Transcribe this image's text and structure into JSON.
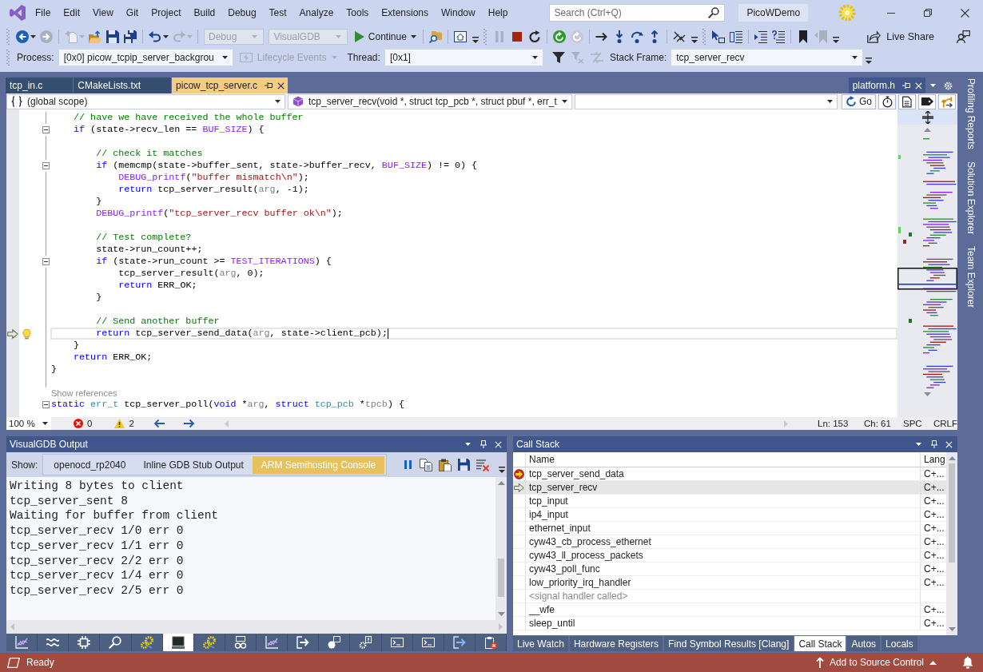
{
  "title_bar": {
    "menu": [
      "File",
      "Edit",
      "View",
      "Git",
      "Project",
      "Build",
      "Debug",
      "Test",
      "Analyze",
      "Tools",
      "Extensions",
      "Window",
      "Help"
    ],
    "search": {
      "placeholder": "Search (Ctrl+Q)"
    },
    "solution": "PicoWDemo"
  },
  "toolbar": {
    "items": [
      {
        "kind": "grip"
      },
      {
        "kind": "back",
        "disabled": false,
        "caret": true
      },
      {
        "kind": "forward",
        "disabled": true,
        "caret": false
      },
      {
        "kind": "separator"
      },
      {
        "kind": "new-item",
        "disabled": true,
        "caret": true
      },
      {
        "kind": "open-folder",
        "disabled": false,
        "caret": false
      },
      {
        "kind": "save",
        "disabled": false,
        "caret": false
      },
      {
        "kind": "save-all",
        "disabled": false,
        "caret": false
      },
      {
        "kind": "separator"
      },
      {
        "kind": "undo",
        "disabled": false,
        "caret": true
      },
      {
        "kind": "redo",
        "disabled": true,
        "caret": true
      },
      {
        "kind": "separator"
      },
      {
        "kind": "combo",
        "value": "Debug",
        "disabled": true
      },
      {
        "kind": "combo",
        "value": "VisualGDB",
        "disabled": true
      },
      {
        "kind": "run",
        "label": "Continue",
        "disabled": false,
        "caret": true
      },
      {
        "kind": "separator"
      },
      {
        "kind": "find-files",
        "disabled": false,
        "caret": false
      },
      {
        "kind": "separator"
      },
      {
        "kind": "home-window",
        "disabled": false,
        "caret": false
      },
      {
        "kind": "overflow"
      },
      {
        "kind": "grip"
      },
      {
        "kind": "pause",
        "disabled": true,
        "caret": false
      },
      {
        "kind": "stop",
        "disabled": false,
        "caret": false
      },
      {
        "kind": "restart",
        "disabled": false,
        "caret": false
      },
      {
        "kind": "separator"
      },
      {
        "kind": "refresh",
        "disabled": false,
        "caret": false
      },
      {
        "kind": "refresh",
        "disabled": true,
        "caret": false
      },
      {
        "kind": "separator"
      },
      {
        "kind": "next-statement",
        "disabled": false,
        "caret": false
      },
      {
        "kind": "step-into",
        "disabled": false,
        "caret": false
      },
      {
        "kind": "step-over",
        "disabled": false,
        "caret": false
      },
      {
        "kind": "step-out",
        "disabled": false,
        "caret": false
      },
      {
        "kind": "separator"
      },
      {
        "kind": "crossed-lines",
        "disabled": false,
        "caret": false
      },
      {
        "kind": "overflow"
      },
      {
        "kind": "grip"
      },
      {
        "kind": "cursor-box",
        "disabled": false,
        "caret": false
      },
      {
        "kind": "panel-list",
        "disabled": false,
        "caret": false
      },
      {
        "kind": "separator"
      },
      {
        "kind": "indent-lines",
        "disabled": false,
        "caret": false
      },
      {
        "kind": "comment-lines",
        "disabled": false,
        "caret": false
      },
      {
        "kind": "separator"
      },
      {
        "kind": "bookmark",
        "disabled": false,
        "caret": false
      },
      {
        "kind": "bookmark-back",
        "disabled": true,
        "caret": false
      },
      {
        "kind": "overflow"
      }
    ],
    "live_share": "Live Share"
  },
  "debug_location": {
    "process_label": "Process:",
    "process": "[0x0] picow_tcpip_server_backgrou",
    "lifecycle": {
      "label": "Lifecycle Events",
      "disabled": true
    },
    "thread_label": "Thread:",
    "thread": "[0x1]",
    "flag_buttons": [
      {
        "kind": "filter",
        "disabled": false
      },
      {
        "kind": "filter-clear",
        "disabled": true
      },
      {
        "kind": "crossed-arrows",
        "disabled": true
      }
    ],
    "stack_frame_label": "Stack Frame:",
    "stack_frame": "tcp_server_recv"
  },
  "documents": {
    "tabs": [
      {
        "label": "tcp_in.c",
        "selected": false
      },
      {
        "label": "CMakeLists.txt",
        "selected": false
      },
      {
        "label": "picow_tcp_server.c",
        "selected": true
      }
    ],
    "side_tab": {
      "label": "platform.h"
    }
  },
  "navigation": {
    "scope": "(global scope)",
    "member": "tcp_server_recv(void *, struct tcp_pcb *, struct pbuf *, err_t",
    "go": "Go"
  },
  "editor": {
    "function_body": [
      {
        "kind": "code",
        "current": false,
        "foldable": false,
        "stack_frame": false,
        "lightbulb": false,
        "segments": [
          {
            "text": "// have we have received the whole buffer",
            "kind": "comment"
          }
        ]
      },
      {
        "kind": "code",
        "current": false,
        "foldable": true,
        "stack_frame": false,
        "lightbulb": false,
        "segments": [
          {
            "text": "if",
            "kind": "keyword"
          },
          {
            "text": " (state->recv_len == ",
            "kind": "plain"
          },
          {
            "text": "BUF_SIZE",
            "kind": "macro"
          },
          {
            "text": ") {",
            "kind": "plain"
          }
        ],
        "children": [
          {
            "kind": "blank",
            "current": false,
            "foldable": false,
            "stack_frame": false,
            "lightbulb": false
          },
          {
            "kind": "code",
            "current": false,
            "foldable": false,
            "stack_frame": false,
            "lightbulb": false,
            "segments": [
              {
                "text": "// check it matches",
                "kind": "comment"
              }
            ]
          },
          {
            "kind": "code",
            "current": false,
            "foldable": true,
            "stack_frame": false,
            "lightbulb": false,
            "segments": [
              {
                "text": "if",
                "kind": "keyword"
              },
              {
                "text": " (memcmp(state->buffer_sent, state->buffer_recv, ",
                "kind": "plain"
              },
              {
                "text": "BUF_SIZE",
                "kind": "macro"
              },
              {
                "text": ") != 0) {",
                "kind": "plain"
              }
            ],
            "children": [
              {
                "kind": "code",
                "current": false,
                "foldable": false,
                "stack_frame": false,
                "lightbulb": false,
                "segments": [
                  {
                    "text": "DEBUG_printf",
                    "kind": "macro"
                  },
                  {
                    "text": "(",
                    "kind": "plain"
                  },
                  {
                    "text": "\"buffer mismatch\\n\"",
                    "kind": "string"
                  },
                  {
                    "text": ");",
                    "kind": "plain"
                  }
                ]
              },
              {
                "kind": "code",
                "current": false,
                "foldable": false,
                "stack_frame": false,
                "lightbulb": false,
                "segments": [
                  {
                    "text": "return",
                    "kind": "keyword"
                  },
                  {
                    "text": " tcp_server_result(",
                    "kind": "plain"
                  },
                  {
                    "text": "arg",
                    "kind": "param"
                  },
                  {
                    "text": ", -1);",
                    "kind": "plain"
                  }
                ]
              }
            ]
          },
          {
            "kind": "code",
            "current": false,
            "foldable": false,
            "stack_frame": false,
            "lightbulb": false,
            "segments": [
              {
                "text": "}",
                "kind": "plain"
              }
            ]
          },
          {
            "kind": "code",
            "current": false,
            "foldable": false,
            "stack_frame": false,
            "lightbulb": false,
            "segments": [
              {
                "text": "DEBUG_printf",
                "kind": "macro"
              },
              {
                "text": "(",
                "kind": "plain"
              },
              {
                "text": "\"tcp_server_recv buffer ok\\n\"",
                "kind": "string"
              },
              {
                "text": ");",
                "kind": "plain"
              }
            ]
          },
          {
            "kind": "blank",
            "current": false,
            "foldable": false,
            "stack_frame": false,
            "lightbulb": false
          },
          {
            "kind": "code",
            "current": false,
            "foldable": false,
            "stack_frame": false,
            "lightbulb": false,
            "segments": [
              {
                "text": "// Test complete?",
                "kind": "comment"
              }
            ]
          },
          {
            "kind": "code",
            "current": false,
            "foldable": false,
            "stack_frame": false,
            "lightbulb": false,
            "segments": [
              {
                "text": "state->run_count++;",
                "kind": "plain"
              }
            ]
          },
          {
            "kind": "code",
            "current": false,
            "foldable": true,
            "stack_frame": false,
            "lightbulb": false,
            "segments": [
              {
                "text": "if",
                "kind": "keyword"
              },
              {
                "text": " (state->run_count >= ",
                "kind": "plain"
              },
              {
                "text": "TEST_ITERATIONS",
                "kind": "macro"
              },
              {
                "text": ") {",
                "kind": "plain"
              }
            ],
            "children": [
              {
                "kind": "code",
                "current": false,
                "foldable": false,
                "stack_frame": false,
                "lightbulb": false,
                "segments": [
                  {
                    "text": "tcp_server_result(",
                    "kind": "plain"
                  },
                  {
                    "text": "arg",
                    "kind": "param"
                  },
                  {
                    "text": ", 0);",
                    "kind": "plain"
                  }
                ]
              },
              {
                "kind": "code",
                "current": false,
                "foldable": false,
                "stack_frame": false,
                "lightbulb": false,
                "segments": [
                  {
                    "text": "return",
                    "kind": "keyword"
                  },
                  {
                    "text": " ERR_OK;",
                    "kind": "plain"
                  }
                ]
              }
            ]
          },
          {
            "kind": "code",
            "current": false,
            "foldable": false,
            "stack_frame": false,
            "lightbulb": false,
            "segments": [
              {
                "text": "}",
                "kind": "plain"
              }
            ]
          },
          {
            "kind": "blank",
            "current": false,
            "foldable": false,
            "stack_frame": false,
            "lightbulb": false
          },
          {
            "kind": "code",
            "current": false,
            "foldable": false,
            "stack_frame": false,
            "lightbulb": false,
            "segments": [
              {
                "text": "// Send another buffer",
                "kind": "comment"
              }
            ]
          },
          {
            "kind": "code",
            "current": true,
            "foldable": false,
            "stack_frame": true,
            "lightbulb": true,
            "segments": [
              {
                "text": "return",
                "kind": "keyword"
              },
              {
                "text": " tcp_server_send_data(",
                "kind": "plain"
              },
              {
                "text": "arg",
                "kind": "param"
              },
              {
                "text": ", state->client_pcb);",
                "kind": "plain"
              }
            ]
          }
        ]
      },
      {
        "kind": "code",
        "current": false,
        "foldable": false,
        "stack_frame": false,
        "lightbulb": false,
        "segments": [
          {
            "text": "}",
            "kind": "plain"
          }
        ]
      },
      {
        "kind": "code",
        "current": false,
        "foldable": false,
        "stack_frame": false,
        "lightbulb": false,
        "segments": [
          {
            "text": "return",
            "kind": "keyword"
          },
          {
            "text": " ERR_OK;",
            "kind": "plain"
          }
        ]
      }
    ],
    "lines_after": [
      {
        "kind": "code",
        "current": false,
        "foldable": false,
        "stack_frame": false,
        "lightbulb": false,
        "segments": [
          {
            "text": "}",
            "kind": "plain"
          }
        ]
      },
      {
        "kind": "blank",
        "current": false,
        "foldable": false,
        "stack_frame": false,
        "lightbulb": false
      },
      {
        "kind": "lens",
        "text": "Show references",
        "current": false,
        "foldable": false,
        "stack_frame": false,
        "lightbulb": false
      },
      {
        "kind": "code",
        "current": false,
        "foldable": true,
        "stack_frame": false,
        "lightbulb": false,
        "segments": [
          {
            "text": "static",
            "kind": "keyword"
          },
          {
            "text": " err_t",
            "kind": "type"
          },
          {
            "text": " tcp_server_poll(",
            "kind": "plain"
          },
          {
            "text": "void",
            "kind": "keyword"
          },
          {
            "text": " *",
            "kind": "plain"
          },
          {
            "text": "arg",
            "kind": "param"
          },
          {
            "text": ", ",
            "kind": "plain"
          },
          {
            "text": "struct",
            "kind": "keyword"
          },
          {
            "text": " tcp_pcb",
            "kind": "type"
          },
          {
            "text": " *",
            "kind": "plain"
          },
          {
            "text": "tpcb",
            "kind": "param"
          },
          {
            "text": ") {",
            "kind": "plain"
          }
        ]
      }
    ]
  },
  "editor_status": {
    "zoom": "100 %",
    "errors": "0",
    "warnings": "2",
    "line": "Ln: 153",
    "column": "Ch: 61",
    "indentation": "SPC",
    "line_ending": "CRLF"
  },
  "output": {
    "title": "VisualGDB Output",
    "show_label": "Show:",
    "sources": [
      {
        "label": "openocd_rp2040",
        "selected": false
      },
      {
        "label": "Inline GDB Stub Output",
        "selected": false
      },
      {
        "label": "ARM Semihosting Console",
        "selected": true
      }
    ],
    "lines": [
      "Writing 8 bytes to client",
      "tcp_server_sent 8",
      "Waiting for buffer from client",
      "tcp_server_recv 1/0 err 0",
      "tcp_server_recv 1/1 err 0",
      "tcp_server_recv 2/2 err 0",
      "tcp_server_recv 1/4 err 0",
      "tcp_server_recv 2/5 err 0"
    ],
    "tool_tabs": [
      {
        "kind": "chart",
        "selected": false
      },
      {
        "kind": "wave",
        "selected": false
      },
      {
        "kind": "chip",
        "selected": false
      },
      {
        "kind": "search",
        "selected": false
      },
      {
        "kind": "gears",
        "selected": false
      },
      {
        "kind": "terminal",
        "selected": true
      },
      {
        "kind": "gears",
        "selected": false
      },
      {
        "kind": "glasses",
        "selected": false
      },
      {
        "kind": "chart",
        "selected": false
      },
      {
        "kind": "arrow-box",
        "selected": false
      },
      {
        "kind": "shapes",
        "selected": false
      },
      {
        "kind": "gear-alert",
        "selected": false
      },
      {
        "kind": "console",
        "selected": false
      },
      {
        "kind": "console",
        "selected": false
      },
      {
        "kind": "arrow-box-blue",
        "selected": false
      },
      {
        "kind": "clipboard-delete",
        "selected": false
      }
    ]
  },
  "call_stack": {
    "title": "Call Stack",
    "columns": [
      "Name",
      "Lang"
    ],
    "rows": [
      {
        "kind": "function",
        "name": "tcp_server_send_data",
        "lang": "C+...",
        "current": true,
        "selected": false
      },
      {
        "kind": "function",
        "name": "tcp_server_recv",
        "lang": "C+...",
        "current": false,
        "selected": true
      },
      {
        "kind": "function",
        "name": "tcp_input",
        "lang": "C+...",
        "current": false,
        "selected": false
      },
      {
        "kind": "function",
        "name": "ip4_input",
        "lang": "C+...",
        "current": false,
        "selected": false
      },
      {
        "kind": "function",
        "name": "ethernet_input",
        "lang": "C+...",
        "current": false,
        "selected": false
      },
      {
        "kind": "function",
        "name": "cyw43_cb_process_ethernet",
        "lang": "C+...",
        "current": false,
        "selected": false
      },
      {
        "kind": "function",
        "name": "cyw43_ll_process_packets",
        "lang": "C+...",
        "current": false,
        "selected": false
      },
      {
        "kind": "function",
        "name": "cyw43_poll_func",
        "lang": "C+...",
        "current": false,
        "selected": false
      },
      {
        "kind": "function",
        "name": "low_priority_irq_handler",
        "lang": "C+...",
        "current": false,
        "selected": false
      },
      {
        "kind": "annotation",
        "name": "<signal handler called>",
        "current": false,
        "selected": false
      },
      {
        "kind": "function",
        "name": "__wfe",
        "lang": "C+...",
        "current": false,
        "selected": false
      },
      {
        "kind": "function",
        "name": "sleep_until",
        "lang": "C+...",
        "current": false,
        "selected": false
      }
    ],
    "tabs": [
      {
        "label": "Live Watch",
        "selected": false
      },
      {
        "label": "Hardware Registers",
        "selected": false
      },
      {
        "label": "Find Symbol Results [Clang]",
        "selected": false
      },
      {
        "label": "Call Stack",
        "selected": true
      },
      {
        "label": "Autos",
        "selected": false
      },
      {
        "label": "Locals",
        "selected": false
      }
    ]
  },
  "side_tabs": [
    "Profiling Reports",
    "Solution Explorer",
    "Team Explorer"
  ],
  "status_bar": {
    "text": "Ready",
    "source_control": "Add to Source Control"
  }
}
